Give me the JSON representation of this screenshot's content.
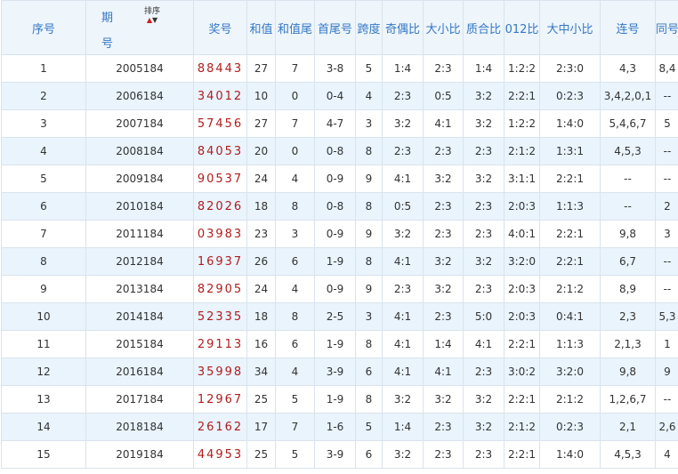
{
  "headers": {
    "seq": "序号",
    "period_top": "期",
    "period_bottom": "号",
    "sort_label": "排序",
    "sort_up_icon": "▲",
    "sort_down_icon": "▼",
    "award": "奖号",
    "sum": "和值",
    "sum_tail": "和值尾",
    "first_last": "首尾号",
    "span": "跨度",
    "odd_even": "奇偶比",
    "big_small": "大小比",
    "prime_composite": "质合比",
    "ratio_012": "012比",
    "big_mid_small": "大中小比",
    "consecutive": "连号",
    "same": "同号"
  },
  "rows": [
    {
      "seq": "1",
      "period": "2005184",
      "award": "88443",
      "sum": "27",
      "tail": "7",
      "fl": "3-8",
      "span": "5",
      "oe": "1:4",
      "bs": "2:3",
      "pc": "1:4",
      "r012": "1:2:2",
      "bms": "2:3:0",
      "cons": "4,3",
      "same": "8,4"
    },
    {
      "seq": "2",
      "period": "2006184",
      "award": "34012",
      "sum": "10",
      "tail": "0",
      "fl": "0-4",
      "span": "4",
      "oe": "2:3",
      "bs": "0:5",
      "pc": "3:2",
      "r012": "2:2:1",
      "bms": "0:2:3",
      "cons": "3,4,2,0,1",
      "same": "--"
    },
    {
      "seq": "3",
      "period": "2007184",
      "award": "57456",
      "sum": "27",
      "tail": "7",
      "fl": "4-7",
      "span": "3",
      "oe": "3:2",
      "bs": "4:1",
      "pc": "3:2",
      "r012": "1:2:2",
      "bms": "1:4:0",
      "cons": "5,4,6,7",
      "same": "5"
    },
    {
      "seq": "4",
      "period": "2008184",
      "award": "84053",
      "sum": "20",
      "tail": "0",
      "fl": "0-8",
      "span": "8",
      "oe": "2:3",
      "bs": "2:3",
      "pc": "2:3",
      "r012": "2:1:2",
      "bms": "1:3:1",
      "cons": "4,5,3",
      "same": "--"
    },
    {
      "seq": "5",
      "period": "2009184",
      "award": "90537",
      "sum": "24",
      "tail": "4",
      "fl": "0-9",
      "span": "9",
      "oe": "4:1",
      "bs": "3:2",
      "pc": "3:2",
      "r012": "3:1:1",
      "bms": "2:2:1",
      "cons": "--",
      "same": "--"
    },
    {
      "seq": "6",
      "period": "2010184",
      "award": "82026",
      "sum": "18",
      "tail": "8",
      "fl": "0-8",
      "span": "8",
      "oe": "0:5",
      "bs": "2:3",
      "pc": "2:3",
      "r012": "2:0:3",
      "bms": "1:1:3",
      "cons": "--",
      "same": "2"
    },
    {
      "seq": "7",
      "period": "2011184",
      "award": "03983",
      "sum": "23",
      "tail": "3",
      "fl": "0-9",
      "span": "9",
      "oe": "3:2",
      "bs": "2:3",
      "pc": "2:3",
      "r012": "4:0:1",
      "bms": "2:2:1",
      "cons": "9,8",
      "same": "3"
    },
    {
      "seq": "8",
      "period": "2012184",
      "award": "16937",
      "sum": "26",
      "tail": "6",
      "fl": "1-9",
      "span": "8",
      "oe": "4:1",
      "bs": "3:2",
      "pc": "3:2",
      "r012": "3:2:0",
      "bms": "2:2:1",
      "cons": "6,7",
      "same": "--"
    },
    {
      "seq": "9",
      "period": "2013184",
      "award": "82905",
      "sum": "24",
      "tail": "4",
      "fl": "0-9",
      "span": "9",
      "oe": "2:3",
      "bs": "3:2",
      "pc": "2:3",
      "r012": "2:0:3",
      "bms": "2:1:2",
      "cons": "8,9",
      "same": "--"
    },
    {
      "seq": "10",
      "period": "2014184",
      "award": "52335",
      "sum": "18",
      "tail": "8",
      "fl": "2-5",
      "span": "3",
      "oe": "4:1",
      "bs": "2:3",
      "pc": "5:0",
      "r012": "2:0:3",
      "bms": "0:4:1",
      "cons": "2,3",
      "same": "5,3"
    },
    {
      "seq": "11",
      "period": "2015184",
      "award": "29113",
      "sum": "16",
      "tail": "6",
      "fl": "1-9",
      "span": "8",
      "oe": "4:1",
      "bs": "1:4",
      "pc": "4:1",
      "r012": "2:2:1",
      "bms": "1:1:3",
      "cons": "2,1,3",
      "same": "1"
    },
    {
      "seq": "12",
      "period": "2016184",
      "award": "35998",
      "sum": "34",
      "tail": "4",
      "fl": "3-9",
      "span": "6",
      "oe": "4:1",
      "bs": "4:1",
      "pc": "2:3",
      "r012": "3:0:2",
      "bms": "3:2:0",
      "cons": "9,8",
      "same": "9"
    },
    {
      "seq": "13",
      "period": "2017184",
      "award": "12967",
      "sum": "25",
      "tail": "5",
      "fl": "1-9",
      "span": "8",
      "oe": "3:2",
      "bs": "3:2",
      "pc": "3:2",
      "r012": "2:2:1",
      "bms": "2:1:2",
      "cons": "1,2,6,7",
      "same": "--"
    },
    {
      "seq": "14",
      "period": "2018184",
      "award": "26162",
      "sum": "17",
      "tail": "7",
      "fl": "1-6",
      "span": "5",
      "oe": "1:4",
      "bs": "2:3",
      "pc": "3:2",
      "r012": "2:1:2",
      "bms": "0:2:3",
      "cons": "2,1",
      "same": "2,6"
    },
    {
      "seq": "15",
      "period": "2019184",
      "award": "44953",
      "sum": "25",
      "tail": "5",
      "fl": "3-9",
      "span": "6",
      "oe": "3:2",
      "bs": "2:3",
      "pc": "2:3",
      "r012": "2:2:1",
      "bms": "1:4:0",
      "cons": "4,5,3",
      "same": "4"
    }
  ],
  "colors": {
    "header_text": "#3478c6",
    "award_red": "#b21c1c",
    "row_stripe": "#e9f4fd",
    "border": "#d9e3ee"
  }
}
